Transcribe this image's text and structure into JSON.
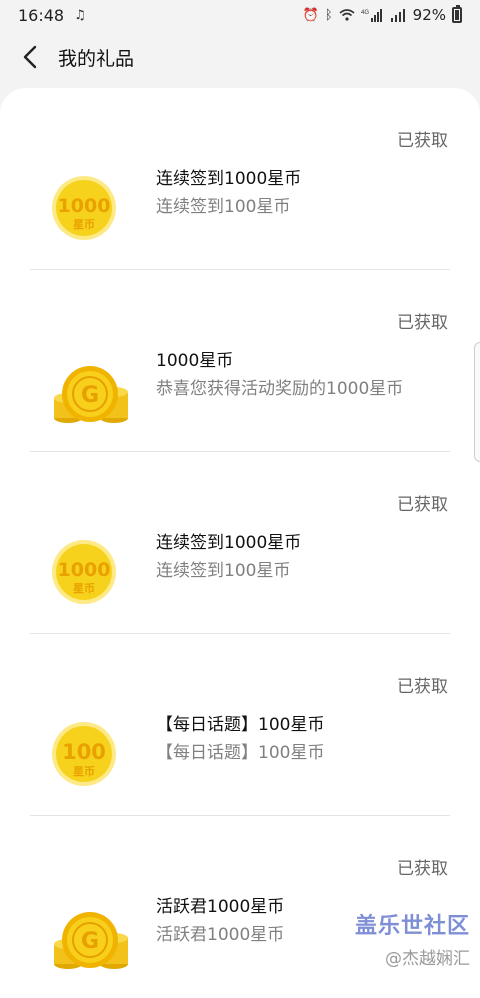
{
  "status_bar": {
    "time": "16:48",
    "battery": "92%",
    "network_label": "4G"
  },
  "header": {
    "title": "我的礼品"
  },
  "gifts": [
    {
      "status": "已获取",
      "title": "连续签到1000星币",
      "desc": "连续签到100星币",
      "icon_type": "coin",
      "coin_value": "1000",
      "coin_unit": "星币"
    },
    {
      "status": "已获取",
      "title": "1000星币",
      "desc": "恭喜您获得活动奖励的1000星币",
      "icon_type": "coin-stack",
      "coin_letter": "G"
    },
    {
      "status": "已获取",
      "title": "连续签到1000星币",
      "desc": "连续签到100星币",
      "icon_type": "coin",
      "coin_value": "1000",
      "coin_unit": "星币"
    },
    {
      "status": "已获取",
      "title": "【每日话题】100星币",
      "desc": "【每日话题】100星币",
      "icon_type": "coin",
      "coin_value": "100",
      "coin_unit": "星币"
    },
    {
      "status": "已获取",
      "title": "活跃君1000星币",
      "desc": "活跃君1000星币",
      "icon_type": "coin-stack",
      "coin_letter": "G"
    }
  ],
  "watermark": {
    "brand": "盖乐世社区",
    "user": "@杰越娴汇"
  },
  "colors": {
    "coin_gold": "#f6d21c",
    "coin_text": "#e9a100",
    "muted_text": "#808080"
  }
}
